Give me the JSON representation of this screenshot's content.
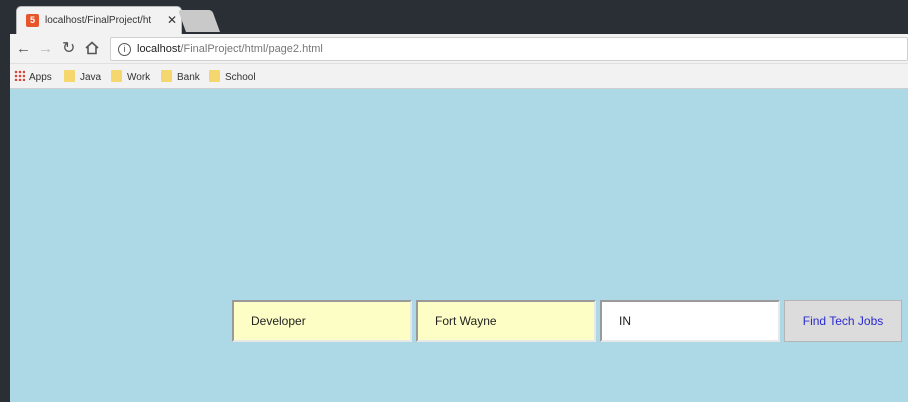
{
  "browser": {
    "tab_title": "localhost/FinalProject/ht",
    "tab_close": "✕",
    "favicon_text": "5",
    "url_host": "localhost",
    "url_path": "/FinalProject/html/page2.html",
    "bookmarks": [
      "Apps",
      "Java",
      "Work",
      "Bank",
      "School"
    ]
  },
  "form": {
    "job_value": "Developer",
    "city_value": "Fort Wayne",
    "state_value": "IN",
    "submit_label": "Find Tech Jobs"
  },
  "colors": {
    "page_background": "#add8e6",
    "filled_input": "#fdfdc6",
    "button_text": "#2a2ad0"
  }
}
